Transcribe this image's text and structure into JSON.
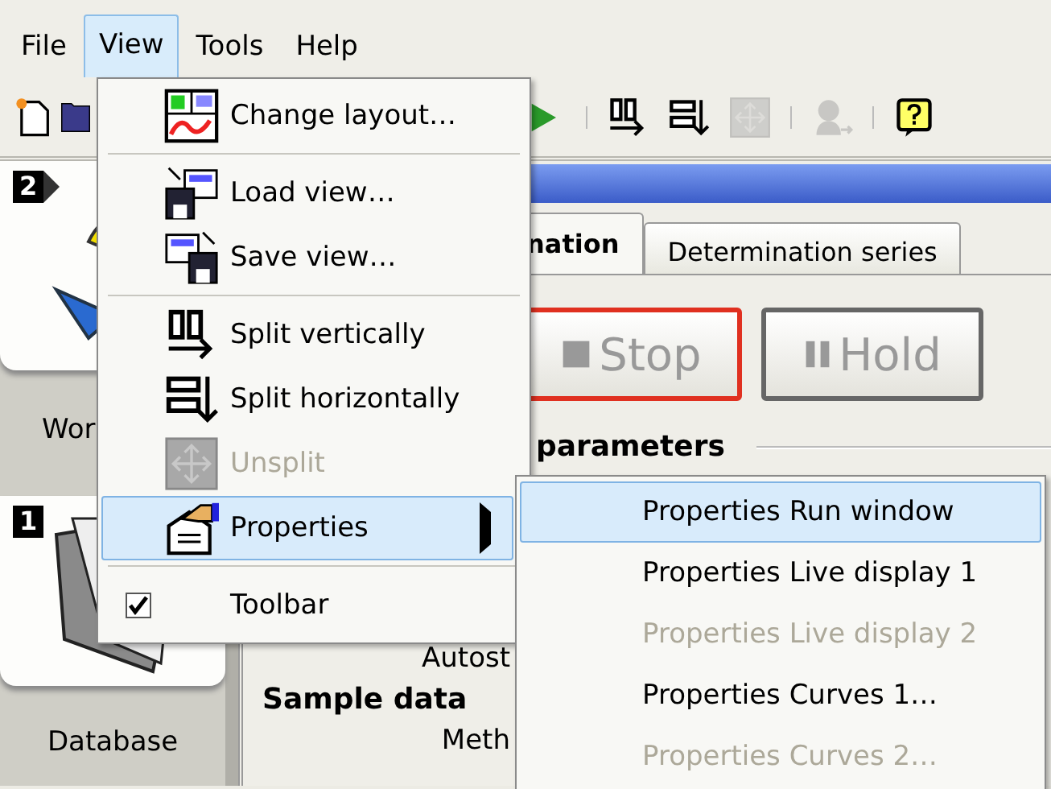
{
  "menubar": [
    {
      "label": "File",
      "selected": false
    },
    {
      "label": "View",
      "selected": true
    },
    {
      "label": "Tools",
      "selected": false
    },
    {
      "label": "Help",
      "selected": false
    }
  ],
  "toolbar": [
    {
      "kind": "new",
      "disabled": false
    },
    {
      "kind": "open",
      "disabled": false
    },
    {
      "kind": "play",
      "disabled": false
    },
    {
      "kind": "separator"
    },
    {
      "kind": "split-vertical",
      "disabled": false
    },
    {
      "kind": "split-horizontal",
      "disabled": false
    },
    {
      "kind": "unsplit",
      "disabled": true
    },
    {
      "kind": "separator"
    },
    {
      "kind": "user",
      "disabled": true
    },
    {
      "kind": "separator"
    },
    {
      "kind": "help",
      "disabled": false
    }
  ],
  "sidebar": [
    {
      "badge": "2",
      "kind": "workplace",
      "label": "Wor"
    },
    {
      "badge": "1",
      "kind": "database",
      "label": "Database"
    }
  ],
  "tabs": [
    {
      "label": "nation",
      "selected": true
    },
    {
      "label": "Determination series",
      "selected": false
    }
  ],
  "buttons": [
    {
      "label": "Stop",
      "kind": "stop",
      "focused": true
    },
    {
      "label": "Hold",
      "kind": "hold",
      "focused": false
    }
  ],
  "section_title": "parameters",
  "form": [
    {
      "kind": "label",
      "text": "Autost"
    },
    {
      "kind": "heading",
      "text": "Sample data"
    },
    {
      "kind": "label",
      "text": "Meth"
    }
  ],
  "view_menu": [
    {
      "kind": "item",
      "label": "Change layout…",
      "disabled": false,
      "selected": false
    },
    {
      "kind": "separator"
    },
    {
      "kind": "item",
      "label": "Load view…",
      "disabled": false,
      "selected": false
    },
    {
      "kind": "item",
      "label": "Save view…",
      "disabled": false,
      "selected": false
    },
    {
      "kind": "separator"
    },
    {
      "kind": "item",
      "label": "Split vertically",
      "disabled": false,
      "selected": false
    },
    {
      "kind": "item",
      "label": "Split horizontally",
      "disabled": false,
      "selected": false
    },
    {
      "kind": "item",
      "label": "Unsplit",
      "disabled": true,
      "selected": false
    },
    {
      "kind": "submenu",
      "label": "Properties",
      "disabled": false,
      "selected": true
    },
    {
      "kind": "separator"
    },
    {
      "kind": "check",
      "label": "Toolbar",
      "checked": true,
      "disabled": false,
      "selected": false
    }
  ],
  "submenu": [
    {
      "label": "Properties Run window",
      "disabled": false,
      "selected": true
    },
    {
      "label": "Properties Live display 1",
      "disabled": false,
      "selected": false
    },
    {
      "label": "Properties Live display 2",
      "disabled": true,
      "selected": false
    },
    {
      "label": "Properties Curves 1…",
      "disabled": false,
      "selected": false
    },
    {
      "label": "Properties Curves 2…",
      "disabled": true,
      "selected": false
    }
  ]
}
